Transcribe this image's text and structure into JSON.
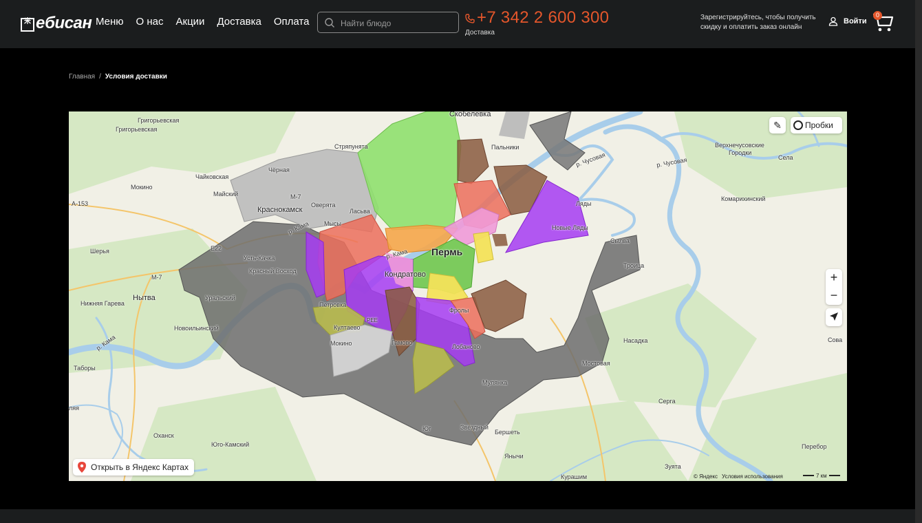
{
  "header": {
    "logo_text": "ебисан",
    "logo_mark": "米",
    "nav": [
      "Меню",
      "О нас",
      "Акции",
      "Доставка",
      "Оплата"
    ],
    "search_placeholder": "Найти блюдо",
    "phone": "+7 342 2 600 300",
    "phone_caption": "Доставка",
    "promo": "Зарегистрируйтесь, чтобы получить скидку и оплатить заказ онлайн",
    "login": "Войти",
    "cart_count": "0",
    "accent": "#e4562b"
  },
  "breadcrumbs": {
    "home": "Главная",
    "separator": "/",
    "current": "Условия доставки"
  },
  "map": {
    "traffic": "Пробки",
    "open_link": "Открыть в Яндекс Картах",
    "copyright": "© Яндекс",
    "terms": "Условия использования",
    "scale": "7 км",
    "zoom_in": "+",
    "zoom_out": "−",
    "labels": {
      "perm": "Пермь",
      "kondratovo": "Кондратово",
      "krasnokamsk": "Краснокамск",
      "skobelevka": "Скобелевка",
      "palniki": "Пальники",
      "strelyata": "Стряпунята",
      "chernaya": "Чёрная",
      "chaikovskaya": "Чайковская",
      "grigorevskaya1": "Григорьевская",
      "grigorevskaya2": "Григорьевская",
      "mokino1": "Мокино",
      "maiskiy": "Майский",
      "overyata": "Оверята",
      "lasva": "Ласьва",
      "myssy": "Мысы",
      "a153": "А-153",
      "m7a": "М-7",
      "m7b": "М-7",
      "e22": "E22",
      "sherya": "Шерья",
      "ustkachka": "Усть-Качка",
      "krasvoshod": "Красный Восход",
      "nytva": "Нытва",
      "nizhgareva": "Нижняя Гарева",
      "uralskiy": "Уральский",
      "novoilinskiy": "Новоильинский",
      "tabory": "Таборы",
      "laya": "ляя",
      "yugokamskiy": "Юго-Камский",
      "okhansk": "Оханск",
      "petrovka": "Петровка",
      "kultaevo": "Култаево",
      "mokino2": "Мокино",
      "gamovo": "Гамово",
      "frolyy": "Фролы",
      "lobanovo": "Лобаново",
      "mulyanka": "Мулянка",
      "yug": "Юг",
      "zvezdny": "Звёздный",
      "bershet": "Бершеть",
      "yanychi": "Янычи",
      "kurashim": "Курашим",
      "lyady": "Ляды",
      "novlyady": "Новые Ляды",
      "sylva": "Сылва",
      "troica": "Троица",
      "komarikhinskiy": "Комарихинский",
      "verhnechus": "Верхнечусовские",
      "gorodki": "Городки",
      "sela": "Села",
      "kama1": "р. Кама",
      "kama2": "р. Кама",
      "kama3": "р. Кама",
      "chusovaya1": "р. Чусовая",
      "chusovaya2": "р. Чусовая",
      "nasadka": "Насадка",
      "sova": "Сова",
      "mostovaya": "Мостовая",
      "serga": "Серга",
      "zuyata": "Зуята",
      "perebor": "Перебор",
      "airport": "PEE"
    }
  }
}
